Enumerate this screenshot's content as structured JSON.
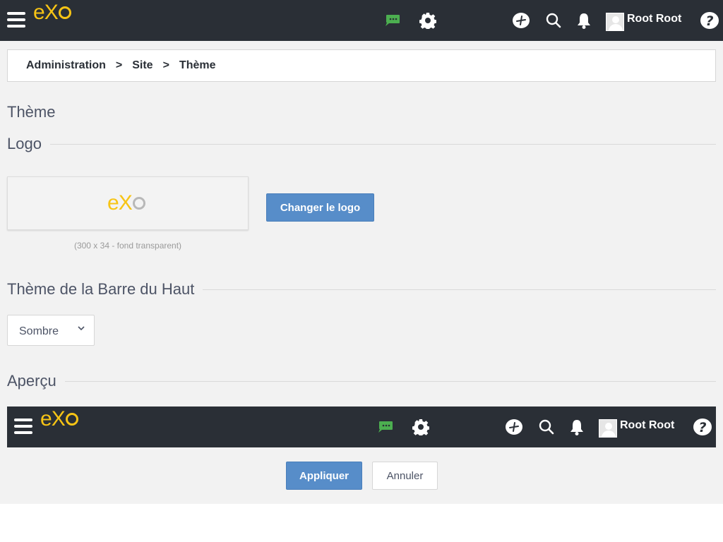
{
  "topbar": {
    "logo_e": "e",
    "logo_x": "X",
    "user_name": "Root Root"
  },
  "breadcrumb": {
    "items": [
      "Administration",
      "Site",
      "Thème"
    ],
    "separator": ">"
  },
  "page_title": "Thème",
  "logo_section": {
    "title": "Logo",
    "hint": "(300 x 34 - fond transparent)",
    "change_button": "Changer le logo"
  },
  "topbar_theme_section": {
    "title": "Thème de la Barre du Haut",
    "selected": "Sombre"
  },
  "preview_section": {
    "title": "Aperçu",
    "user_name": "Root Root"
  },
  "actions": {
    "apply": "Appliquer",
    "cancel": "Annuler"
  },
  "colors": {
    "topbar_bg": "#2a2f36",
    "accent_yellow": "#f7c415",
    "primary_button": "#578dc9",
    "chat_green": "#4caf50",
    "page_bg": "#f2f2f2"
  },
  "icons": [
    "hamburger-icon",
    "exo-logo",
    "chat-icon",
    "gear-icon",
    "add-icon",
    "search-icon",
    "bell-icon",
    "avatar",
    "help-icon",
    "chevron-down-icon"
  ]
}
